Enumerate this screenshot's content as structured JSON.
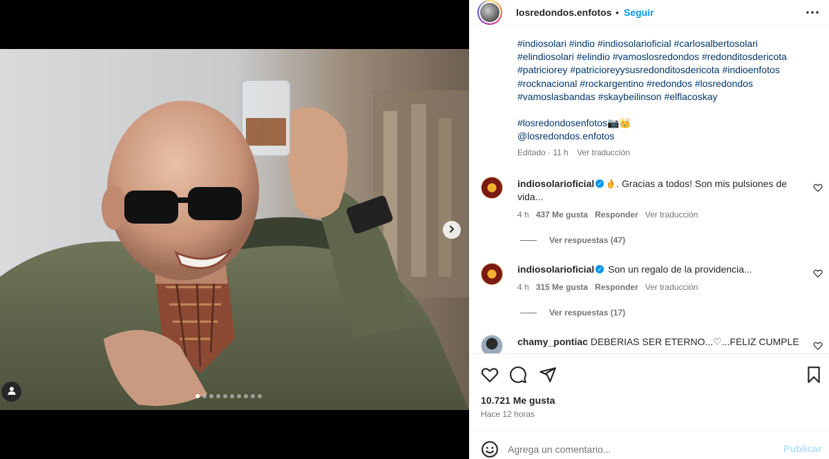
{
  "post": {
    "media": {
      "carousel_total": 10,
      "carousel_active_index": 0
    }
  },
  "header": {
    "username": "losredondos.enfotos",
    "separator": "•",
    "follow_label": "Seguir",
    "more_icon": "more-horizontal-icon"
  },
  "caption": {
    "hashtag_lines": [
      "#indiosolari #indio #indiosolarioficial #carlosalbertosolari",
      "#elindiosolari #elindio #vamoslosredondos #redonditosdericota",
      "#patriciorey #patricioreyysusredonditosdericota #indioenfotos",
      "#rocknacional #rockargentino #redondos #losredondos",
      "#vamoslasbandas #skaybeilinson #elflacoskay"
    ],
    "tag_line": "#losredondosenfotos📷👑",
    "mention": "@losredondos.enfotos",
    "edited_label": "Editado",
    "dot": "·",
    "time": "11 h",
    "translate_label": "Ver traducción"
  },
  "comments": [
    {
      "username": "indiosolarioficial",
      "verified_glyph": "✓",
      "text_line1": ". Gracias a todos! Son mis pulsiones de",
      "text_line2": "vida...",
      "time": "4 h",
      "likes": "437 Me gusta",
      "reply_label": "Responder",
      "translate_label": "Ver traducción",
      "view_replies": "Ver respuestas (47)"
    },
    {
      "username": "indiosolarioficial",
      "verified_glyph": "✓",
      "text": "Son un regalo de la providencia...",
      "time": "4 h",
      "likes": "315 Me gusta",
      "reply_label": "Responder",
      "translate_label": "Ver traducción",
      "view_replies": "Ver respuestas (17)"
    },
    {
      "username": "chamy_pontiac",
      "text": "DEBERIAS SER ETERNO...♡...FELIZ CUMPLE"
    }
  ],
  "actions": {
    "icons": [
      "heart-icon",
      "comment-icon",
      "share-icon",
      "bookmark-icon"
    ],
    "likes_count": "10.721 Me gusta",
    "posted_ago": "Hace 12 horas"
  },
  "add_comment": {
    "placeholder": "Agrega un comentario...",
    "publish_label": "Publicar"
  },
  "colors": {
    "link": "#00376b",
    "accent": "#0095f6",
    "muted": "#737373",
    "publish_disabled": "#b2dffc"
  }
}
